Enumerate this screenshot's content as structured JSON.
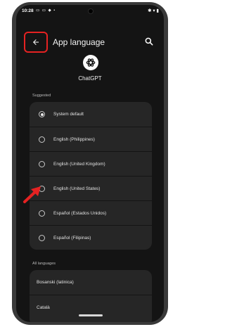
{
  "status_bar": {
    "time": "10:28",
    "left_icons": "▭ ▭ ◆ •",
    "right_icons": "✱ ▾ ▮"
  },
  "header": {
    "back_icon": "arrow-left-icon",
    "title": "App language",
    "search_icon": "search-icon"
  },
  "app": {
    "name": "ChatGPT",
    "icon": "openai-logo-icon"
  },
  "suggested": {
    "label": "Suggested",
    "items": [
      {
        "label": "System default",
        "selected": true
      },
      {
        "label": "English (Philippines)",
        "selected": false
      },
      {
        "label": "English (United Kingdom)",
        "selected": false
      },
      {
        "label": "English (United States)",
        "selected": false
      },
      {
        "label": "Español (Estados Unidos)",
        "selected": false
      },
      {
        "label": "Español (Filipinas)",
        "selected": false
      }
    ]
  },
  "all_languages": {
    "label": "All languages",
    "items": [
      {
        "label": "Bosanski (latinica)"
      },
      {
        "label": "Català"
      }
    ]
  },
  "colors": {
    "highlight": "#e52222",
    "background": "#141414",
    "card": "#262626"
  }
}
